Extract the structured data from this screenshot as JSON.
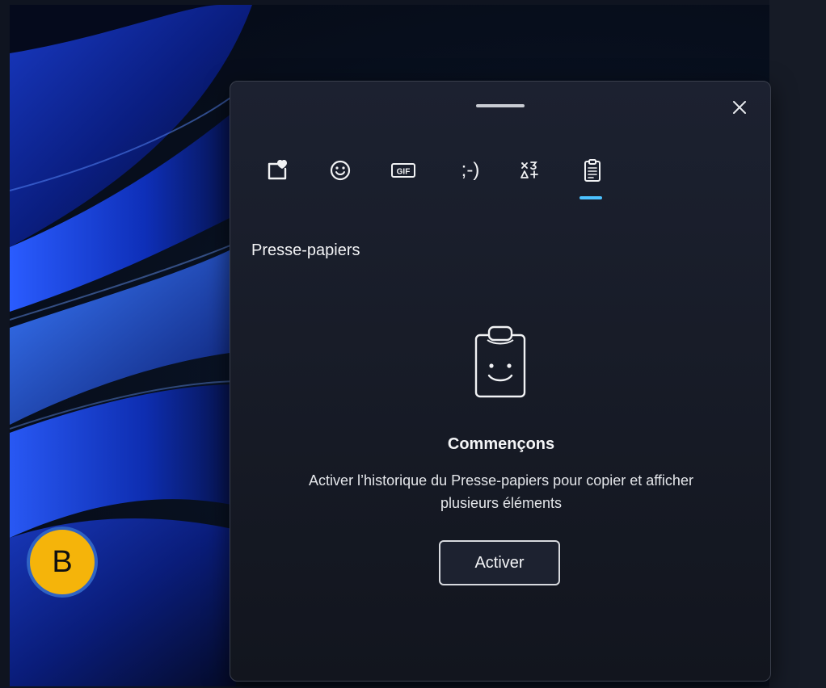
{
  "panel": {
    "section_title": "Presse-papiers",
    "tabs": [
      {
        "name": "favorites",
        "icon": "heart-square-icon"
      },
      {
        "name": "emoji",
        "icon": "smiley-icon"
      },
      {
        "name": "gif",
        "icon": "gif-icon",
        "label": "GIF"
      },
      {
        "name": "kaomoji",
        "icon": "kaomoji-icon",
        "label": ";-)"
      },
      {
        "name": "symbols",
        "icon": "symbols-icon"
      },
      {
        "name": "clipboard",
        "icon": "clipboard-icon",
        "selected": true
      }
    ],
    "empty_state": {
      "heading": "Commençons",
      "description": "Activer l’historique du Presse-papiers pour copier et afficher plusieurs éléments",
      "button_label": "Activer"
    }
  },
  "badge": {
    "label": "B"
  },
  "colors": {
    "accent": "#4cc2ff",
    "badge_fill": "#f5b40a",
    "badge_border": "#2f63c4"
  }
}
